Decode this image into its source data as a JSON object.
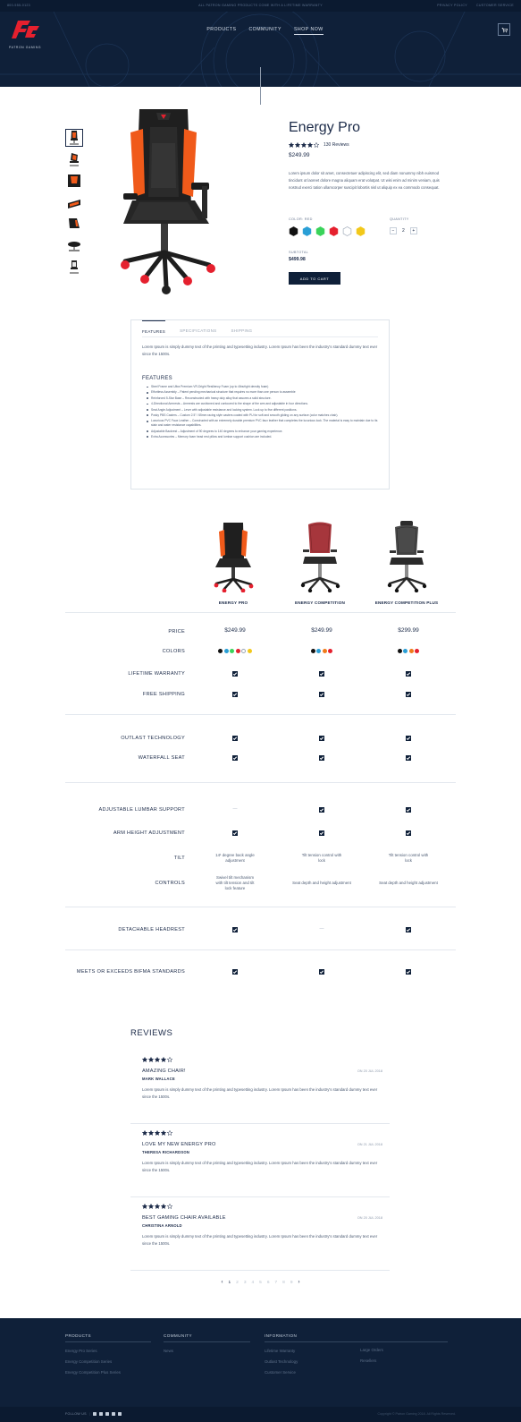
{
  "topbar": {
    "phone": "800-555-0123",
    "promo": "ALL PATRON GAMING PRODUCTS COME WITH A LIFETIME WARRANTY",
    "links": [
      "PRIVACY POLICY",
      "CUSTOMER SERVICE"
    ]
  },
  "brand": {
    "logo_text": "PATRON GAMING",
    "accent": "#e5202e",
    "navy": "#0f2039"
  },
  "nav": [
    {
      "label": "PRODUCTS",
      "active": false
    },
    {
      "label": "COMMUNITY",
      "active": false
    },
    {
      "label": "SHOP NOW",
      "active": true
    }
  ],
  "cart_icon": "cart-icon",
  "product": {
    "name": "Energy Pro",
    "rating": 4,
    "reviews_label": "130 Reviews",
    "price": "$249.99",
    "description": "Lorem ipsum dolor sit amet, consectetuer adipiscing elit, sed diam nonummy nibh euismod tincidunt ut laoreet dolore magna aliquam erat volutpat. Ut wisi enim ad minim veniam, quis nostrud exerci tation ullamcorper suscipit lobortis nisl ut aliquip ex ea commodo consequat.",
    "color_label": "COLOR: RED",
    "colors": [
      "#111111",
      "#2a9fd6",
      "#3ad35a",
      "#e5202e",
      "#ffffff",
      "#f2c81a"
    ],
    "selected_color": 3,
    "quantity_label": "QUANTITY",
    "quantity": "2",
    "qty_minus": "−",
    "qty_plus": "+",
    "subtotal_label": "SUBTOTAL",
    "subtotal": "$499.98",
    "add_to_cart": "ADD TO CART"
  },
  "tabs": {
    "items": [
      "FEATURES",
      "SPECIFICATIONS",
      "SHIPPING"
    ],
    "active": 0,
    "intro": "Lorem Ipsum is simply dummy text of the printing and typesetting industry. Lorem Ipsum has been the industry's standard dummy text ever since the 1500s.",
    "features_heading": "FEATURES",
    "features": [
      "Steel Frame and Ultra Premium VR-Dright Resiliency Foam (up to 4lbs/right density foam)",
      "Effortless Assembly – Patent pending mechanical structure that requires no more than one person to assemble",
      "Reinforced 5-Star Base – Reconstructed with heavy duty alloy that assures a solid structure.",
      "4-Directional Armrests – Armrests are cushioned and contoured to the shape of the arm and adjustable in four directions.",
      "Seat Angle Adjustment – Lever with adjustable resistance and locking system. Lock up to five different positions.",
      "Posky PBS Casters – Custom 2.5\" / 65mm racing style casters coated with PU for soft and smooth gliding on any surface (color matches chair).",
      "Luxurious PVC Faux Leather – Constructed with an extremely durable premium PVC faux leather that completes the luxurious look. The material is easy to maintain due to its stain and water resistance capabilities.",
      "Adjustable Backrest – Adjustment of 90 degrees to 140 degrees to enhance your gaming experience.",
      "Extra Accessories – Memory foam head rest pillow and lumbar support cushion are included."
    ]
  },
  "comparison": {
    "products": [
      {
        "name": "ENERGY PRO",
        "price": "$249.99",
        "colors": [
          "#111111",
          "#2a9fd6",
          "#3ad35a",
          "#e5202e",
          "#ffffff",
          "#f2c81a"
        ]
      },
      {
        "name": "ENERGY COMPETITION",
        "price": "$249.99",
        "colors": [
          "#111111",
          "#2a9fd6",
          "#f07a1a",
          "#e5202e"
        ]
      },
      {
        "name": "ENERGY COMPETITION PLUS",
        "price": "$299.99",
        "colors": [
          "#111111",
          "#2a9fd6",
          "#f07a1a",
          "#e5202e"
        ]
      }
    ],
    "rows": [
      {
        "label": "PRICE",
        "type": "price"
      },
      {
        "label": "COLORS",
        "type": "colors"
      },
      {
        "label": "LIFETIME WARRANTY",
        "values": [
          true,
          true,
          true
        ]
      },
      {
        "label": "FREE SHIPPING",
        "values": [
          true,
          true,
          true
        ]
      },
      {
        "label": "OUTLAST TECHNOLOGY",
        "values": [
          true,
          true,
          true
        ]
      },
      {
        "label": "WATERFALL SEAT",
        "values": [
          true,
          true,
          true
        ]
      },
      {
        "label": "ADJUSTABLE LUMBAR SUPPORT",
        "values": [
          false,
          true,
          true
        ]
      },
      {
        "label": "ARM HEIGHT ADJUSTMENT",
        "values": [
          true,
          true,
          true
        ]
      },
      {
        "label": "TILT",
        "values": [
          "14¹ degree back angle adjustment",
          "Tilt tension control with lock",
          "Tilt tension control with lock"
        ]
      },
      {
        "label": "CONTROLS",
        "values": [
          "Swivel tilt mechanism with tilt tension and tilt lock feature",
          "Seat depth and height adjustment",
          "Seat depth and height adjustment"
        ]
      },
      {
        "label": "DETACHABLE HEADREST",
        "values": [
          true,
          false,
          true
        ]
      },
      {
        "label": "MEETS OR EXCEEDS BIFMA STANDARDS",
        "values": [
          true,
          true,
          true
        ]
      }
    ],
    "dash": "—"
  },
  "reviews": {
    "heading": "REVIEWS",
    "items": [
      {
        "rating": 4,
        "title": "AMAZING CHAIR!",
        "author": "MARK WALLACE",
        "date": "ON 20 JUL 2018",
        "text": "Lorem Ipsum is simply dummy text of the printing and typesetting industry. Lorem Ipsum has been the industry's standard dummy text ever since the 1500s."
      },
      {
        "rating": 4,
        "title": "LOVE MY NEW ENERGY PRO",
        "author": "THERESA RICHARDSON",
        "date": "ON 21 JUL 2018",
        "text": "Lorem Ipsum is simply dummy text of the printing and typesetting industry. Lorem Ipsum has been the industry's standard dummy text ever since the 1500s."
      },
      {
        "rating": 4,
        "title": "BEST GAMING CHAIR AVAILABLE",
        "author": "CHRISTINA ARNOLD",
        "date": "ON 20 JUL 2018",
        "text": "Lorem Ipsum is simply dummy text of the printing and typesetting industry. Lorem Ipsum has been the industry's standard dummy text ever since the 1500s."
      }
    ],
    "pager": {
      "prev": "‹",
      "next": "›",
      "pages": [
        "1",
        "2",
        "3",
        "4",
        "5",
        "6",
        "7",
        "8",
        "9"
      ],
      "current": 0
    }
  },
  "footer": {
    "columns": [
      {
        "heading": "PRODUCTS",
        "items": [
          "Energy Pro Series",
          "Energy Competition Series",
          "Energy Competition Plus Series"
        ]
      },
      {
        "heading": "COMMUNITY",
        "items": [
          "News"
        ]
      },
      {
        "heading": "INFORMATION",
        "items": [
          "Lifetime Warranty",
          "Outlast Technology",
          "Customer Service"
        ]
      }
    ],
    "info_extra": [
      "Large Orders",
      "Resellers"
    ],
    "follow_label": "FOLLOW US",
    "social_icons": [
      "facebook-icon",
      "twitter-icon",
      "instagram-icon",
      "twitch-icon",
      "pinterest-icon"
    ],
    "copyright": "Copyright © Patron Gaming 2018. All Rights Reserved."
  }
}
